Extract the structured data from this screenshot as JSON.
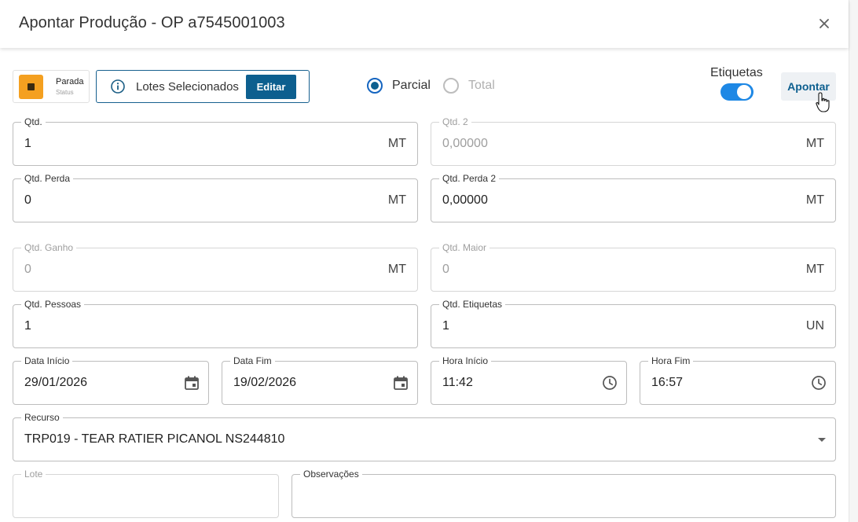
{
  "header": {
    "title": "Apontar Produção - OP a7545001003",
    "close_icon": "close-icon"
  },
  "status": {
    "label": "Parada",
    "sublabel": "Status",
    "color": "#f4a020"
  },
  "lotes": {
    "label": "Lotes Selecionados",
    "edit_label": "Editar",
    "icon": "info-icon"
  },
  "mode": {
    "options": [
      "Parcial",
      "Total"
    ],
    "selected": "Parcial"
  },
  "etiquetas": {
    "label": "Etiquetas",
    "enabled": true
  },
  "apontar_label": "Apontar",
  "fields": {
    "qtd": {
      "label": "Qtd.",
      "value": "1",
      "unit": "MT"
    },
    "qtd2": {
      "label": "Qtd. 2",
      "value": "0,00000",
      "unit": "MT"
    },
    "qtd_perda": {
      "label": "Qtd. Perda",
      "value": "0",
      "unit": "MT"
    },
    "qtd_perda2": {
      "label": "Qtd. Perda 2",
      "value": "0,00000",
      "unit": "MT"
    },
    "qtd_ganho": {
      "label": "Qtd. Ganho",
      "value": "0",
      "unit": "MT"
    },
    "qtd_maior": {
      "label": "Qtd. Maior",
      "value": "0",
      "unit": "MT"
    },
    "qtd_pessoas": {
      "label": "Qtd. Pessoas",
      "value": "1"
    },
    "qtd_etiquetas": {
      "label": "Qtd. Etiquetas",
      "value": "1",
      "unit": "UN"
    },
    "data_inicio": {
      "label": "Data Início",
      "value": "29/01/2026"
    },
    "data_fim": {
      "label": "Data Fim",
      "value": "19/02/2026"
    },
    "hora_inicio": {
      "label": "Hora Início",
      "value": "11:42"
    },
    "hora_fim": {
      "label": "Hora Fim",
      "value": "16:57"
    },
    "recurso": {
      "label": "Recurso",
      "value": "TRP019 - TEAR RATIER PICANOL NS244810"
    },
    "lote": {
      "label": "Lote",
      "value": ""
    },
    "observacoes": {
      "label": "Observações",
      "value": ""
    }
  }
}
